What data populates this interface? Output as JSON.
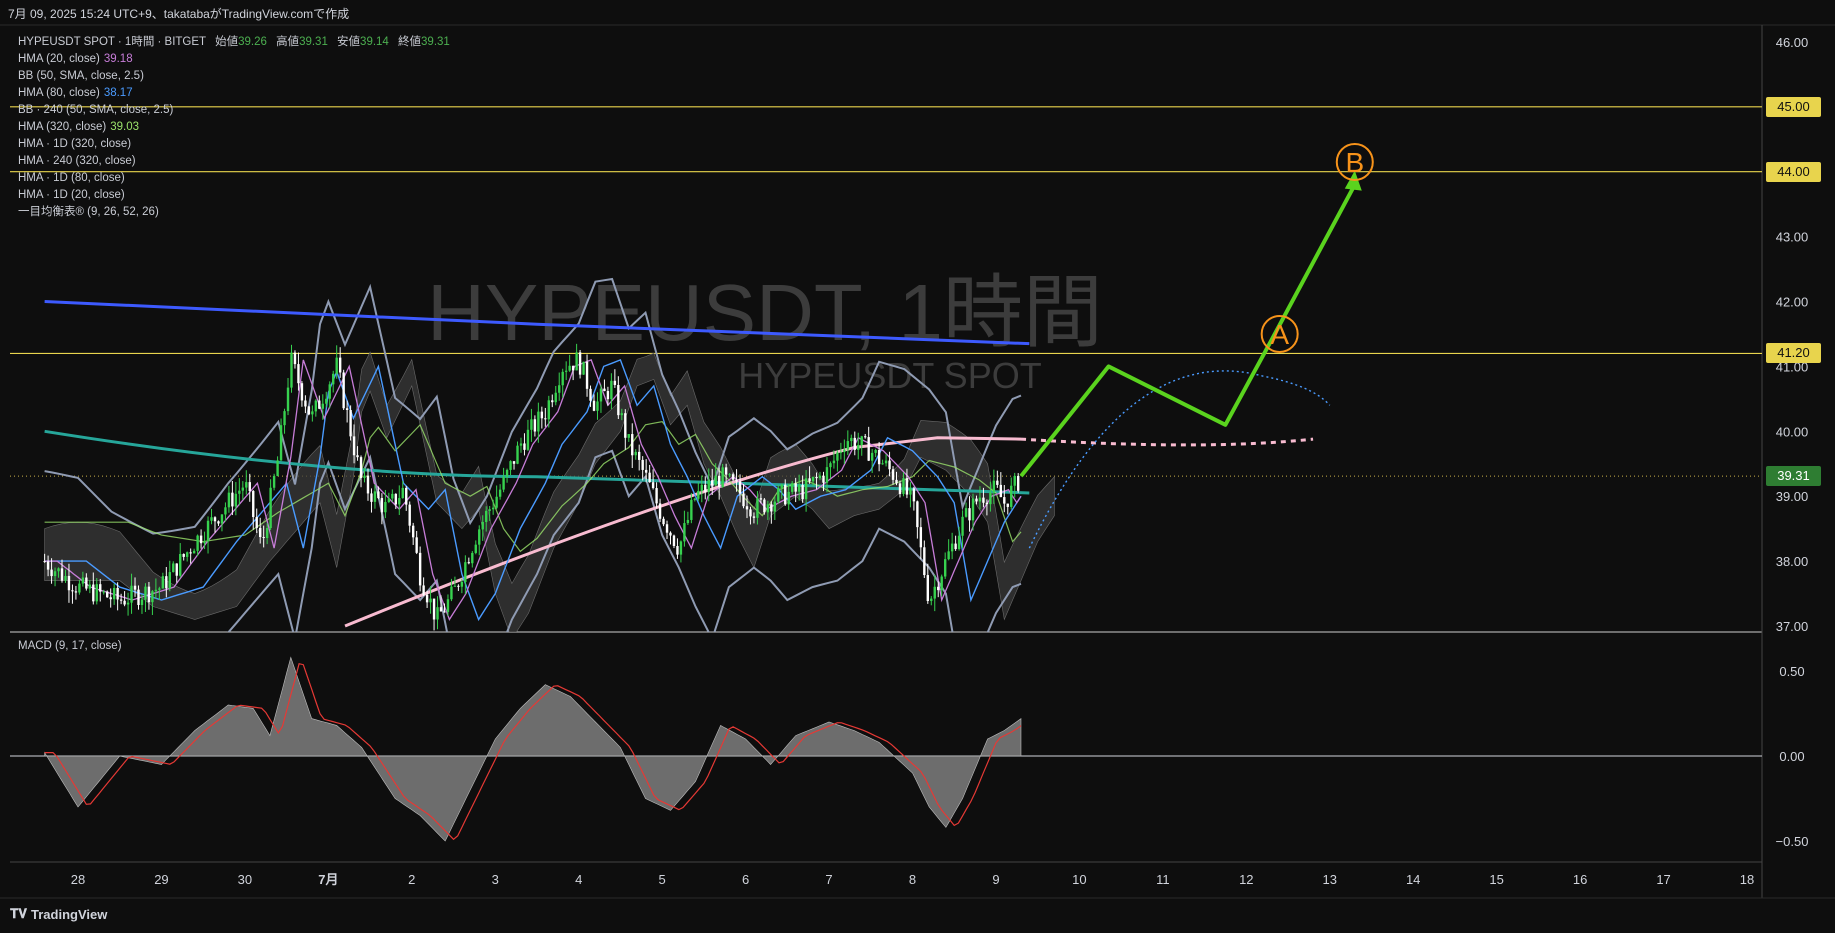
{
  "header": {
    "text": "7月 09, 2025 15:24 UTC+9、takatabaがTradingView.comで作成"
  },
  "symbol_line": {
    "symbol": "HYPEUSDT SPOT · 1時間 · BITGET",
    "open_label": "始値",
    "open": "39.26",
    "high_label": "高値",
    "high": "39.31",
    "low_label": "安値",
    "low": "39.14",
    "close_label": "終値",
    "close": "39.31"
  },
  "indicators": [
    {
      "label": "HMA (20, close)",
      "value": "39.18",
      "color": "#c77dd8"
    },
    {
      "label": "BB (50, SMA, close, 2.5)",
      "value": "",
      "color": "#c9ccd4"
    },
    {
      "label": "HMA (80, close)",
      "value": "38.17",
      "color": "#4a9bff"
    },
    {
      "label": "BB · 240 (50, SMA, close, 2.5)",
      "value": "",
      "color": "#c9ccd4"
    },
    {
      "label": "HMA (320, close)",
      "value": "39.03",
      "color": "#9be36b"
    },
    {
      "label": "HMA · 1D (320, close)",
      "value": "",
      "color": "#c9ccd4"
    },
    {
      "label": "HMA · 240 (320, close)",
      "value": "",
      "color": "#c9ccd4"
    },
    {
      "label": "HMA · 1D (80, close)",
      "value": "",
      "color": "#c9ccd4"
    },
    {
      "label": "HMA · 1D (20, close)",
      "value": "",
      "color": "#c9ccd4"
    },
    {
      "label": "一目均衡表® (9, 26, 52, 26)",
      "value": "",
      "color": "#c9ccd4"
    }
  ],
  "watermark": {
    "line1": "HYPEUSDT, 1時間",
    "line2": "HYPEUSDT SPOT"
  },
  "macd_label": "MACD (9, 17, close)",
  "footer": {
    "brand": "TradingView"
  },
  "colors": {
    "up": "#37d24f",
    "down": "#ffffff",
    "projection": "#5ad31e",
    "hline": "#e8d44d",
    "marker": "#f7931a"
  },
  "chart_data": [
    {
      "type": "candlestick",
      "x_ticks": [
        "28",
        "29",
        "30",
        "7月",
        "2",
        "3",
        "4",
        "5",
        "6",
        "7",
        "8",
        "9",
        "10",
        "11",
        "12",
        "13",
        "14",
        "15",
        "16",
        "17",
        "18"
      ],
      "y_ticks": [
        "37.00",
        "38.00",
        "39.00",
        "40.00",
        "41.00",
        "42.00",
        "43.00",
        "44.00",
        "45.00",
        "46.00"
      ],
      "ylim": [
        37.0,
        46.3
      ],
      "current_price": "39.31",
      "horizontal_levels": [
        "45.00",
        "44.00",
        "41.20"
      ],
      "price_path": [
        [
          27.6,
          38.0
        ],
        [
          28.0,
          37.6
        ],
        [
          28.5,
          37.4
        ],
        [
          29.0,
          37.6
        ],
        [
          29.4,
          38.3
        ],
        [
          29.8,
          38.9
        ],
        [
          30.0,
          39.2
        ],
        [
          30.2,
          38.2
        ],
        [
          30.4,
          39.6
        ],
        [
          30.55,
          41.1
        ],
        [
          30.8,
          40.2
        ],
        [
          31.1,
          41.0
        ],
        [
          31.4,
          39.2
        ],
        [
          31.7,
          38.8
        ],
        [
          31.9,
          39.1
        ],
        [
          32.1,
          37.8
        ],
        [
          32.3,
          37.1
        ],
        [
          32.5,
          37.5
        ],
        [
          32.8,
          38.5
        ],
        [
          33.1,
          39.2
        ],
        [
          33.3,
          39.8
        ],
        [
          33.6,
          40.3
        ],
        [
          33.8,
          41.0
        ],
        [
          34.0,
          41.1
        ],
        [
          34.2,
          40.4
        ],
        [
          34.4,
          40.7
        ],
        [
          34.6,
          39.8
        ],
        [
          34.8,
          39.3
        ],
        [
          35.0,
          38.7
        ],
        [
          35.2,
          38.2
        ],
        [
          35.4,
          39.0
        ],
        [
          35.7,
          39.3
        ],
        [
          35.9,
          39.1
        ],
        [
          36.1,
          38.8
        ],
        [
          36.4,
          39.0
        ],
        [
          36.7,
          39.1
        ],
        [
          37.0,
          39.4
        ],
        [
          37.2,
          39.9
        ],
        [
          37.5,
          39.7
        ],
        [
          37.8,
          39.3
        ],
        [
          38.0,
          38.9
        ],
        [
          38.2,
          37.4
        ],
        [
          38.4,
          38.0
        ],
        [
          38.6,
          38.6
        ],
        [
          38.8,
          39.0
        ],
        [
          39.0,
          39.1
        ],
        [
          39.1,
          38.9
        ],
        [
          39.2,
          39.1
        ],
        [
          39.3,
          39.3
        ]
      ],
      "projection": [
        [
          39.3,
          39.31
        ],
        [
          40.35,
          41.0
        ],
        [
          41.75,
          40.1
        ],
        [
          42.3,
          41.4
        ],
        [
          43.3,
          43.8
        ]
      ],
      "markers": [
        {
          "label": "A",
          "x": 42.4,
          "y": 41.5
        },
        {
          "label": "B",
          "x": 43.3,
          "y": 44.15
        }
      ]
    },
    {
      "type": "area",
      "name": "",
      "y_ticks": [
        "0.50",
        "0.00",
        "−0.50"
      ],
      "ylim": [
        -0.62,
        0.62
      ],
      "x": [
        27.6,
        28.0,
        28.5,
        29.0,
        29.4,
        29.8,
        30.1,
        30.3,
        30.55,
        30.8,
        31.1,
        31.4,
        31.8,
        32.1,
        32.4,
        32.7,
        33.0,
        33.3,
        33.6,
        33.9,
        34.2,
        34.5,
        34.8,
        35.1,
        35.4,
        35.7,
        36.0,
        36.3,
        36.6,
        37.0,
        37.3,
        37.6,
        38.0,
        38.2,
        38.4,
        38.6,
        38.9,
        39.1,
        39.3
      ],
      "values": [
        0.02,
        -0.3,
        0.0,
        -0.05,
        0.15,
        0.3,
        0.28,
        0.12,
        0.58,
        0.22,
        0.18,
        0.05,
        -0.25,
        -0.35,
        -0.5,
        -0.2,
        0.1,
        0.28,
        0.42,
        0.35,
        0.2,
        0.05,
        -0.25,
        -0.32,
        -0.15,
        0.18,
        0.1,
        -0.05,
        0.12,
        0.2,
        0.15,
        0.08,
        -0.1,
        -0.3,
        -0.42,
        -0.25,
        0.1,
        0.15,
        0.22
      ]
    }
  ]
}
